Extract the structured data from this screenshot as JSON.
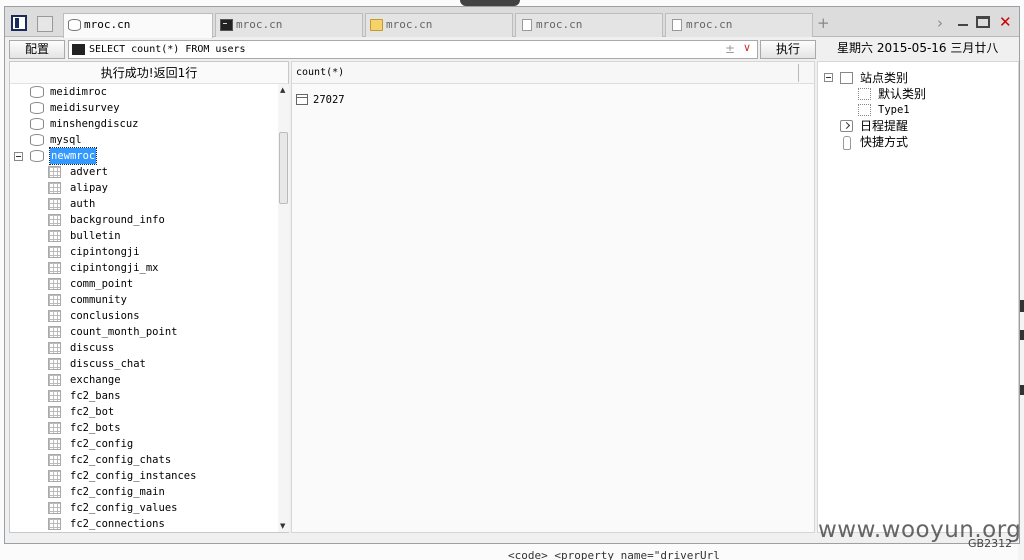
{
  "tabs": [
    {
      "label": "mroc.cn",
      "icon": "database-icon",
      "active": true
    },
    {
      "label": "mroc.cn",
      "icon": "terminal-icon",
      "active": false
    },
    {
      "label": "mroc.cn",
      "icon": "folder-icon",
      "active": false
    },
    {
      "label": "mroc.cn",
      "icon": "file-icon",
      "active": false
    },
    {
      "label": "mroc.cn",
      "icon": "file-icon",
      "active": false
    }
  ],
  "tab_add_label": "+",
  "toolbar": {
    "config_label": "配置",
    "query_value": "SELECT count(*) FROM users",
    "plus_minus": "±",
    "dropdown_glyph": "∨",
    "execute_label": "执行",
    "date_text": "星期六 2015-05-16 三月廿八"
  },
  "left_panel": {
    "status": "执行成功!返回1行",
    "databases": [
      "meidimroc",
      "meidisurvey",
      "minshengdiscuz",
      "mysql"
    ],
    "selected_database": "newmroc",
    "tables": [
      "advert",
      "alipay",
      "auth",
      "background_info",
      "bulletin",
      "cipintongji",
      "cipintongji_mx",
      "comm_point",
      "community",
      "conclusions",
      "count_month_point",
      "discuss",
      "discuss_chat",
      "exchange",
      "fc2_bans",
      "fc2_bot",
      "fc2_bots",
      "fc2_config",
      "fc2_config_chats",
      "fc2_config_instances",
      "fc2_config_main",
      "fc2_config_values",
      "fc2_connections"
    ]
  },
  "grid": {
    "column": "count(*)",
    "value": "27027"
  },
  "right_panel": {
    "category_title": "站点类别",
    "categories": [
      "默认类别",
      "Type1"
    ],
    "schedule": "日程提醒",
    "shortcuts": "快捷方式"
  },
  "watermark": "www.wooyun.org",
  "encoding": "GB2312",
  "background_text": "<code>   <property name=\"driverUrl"
}
